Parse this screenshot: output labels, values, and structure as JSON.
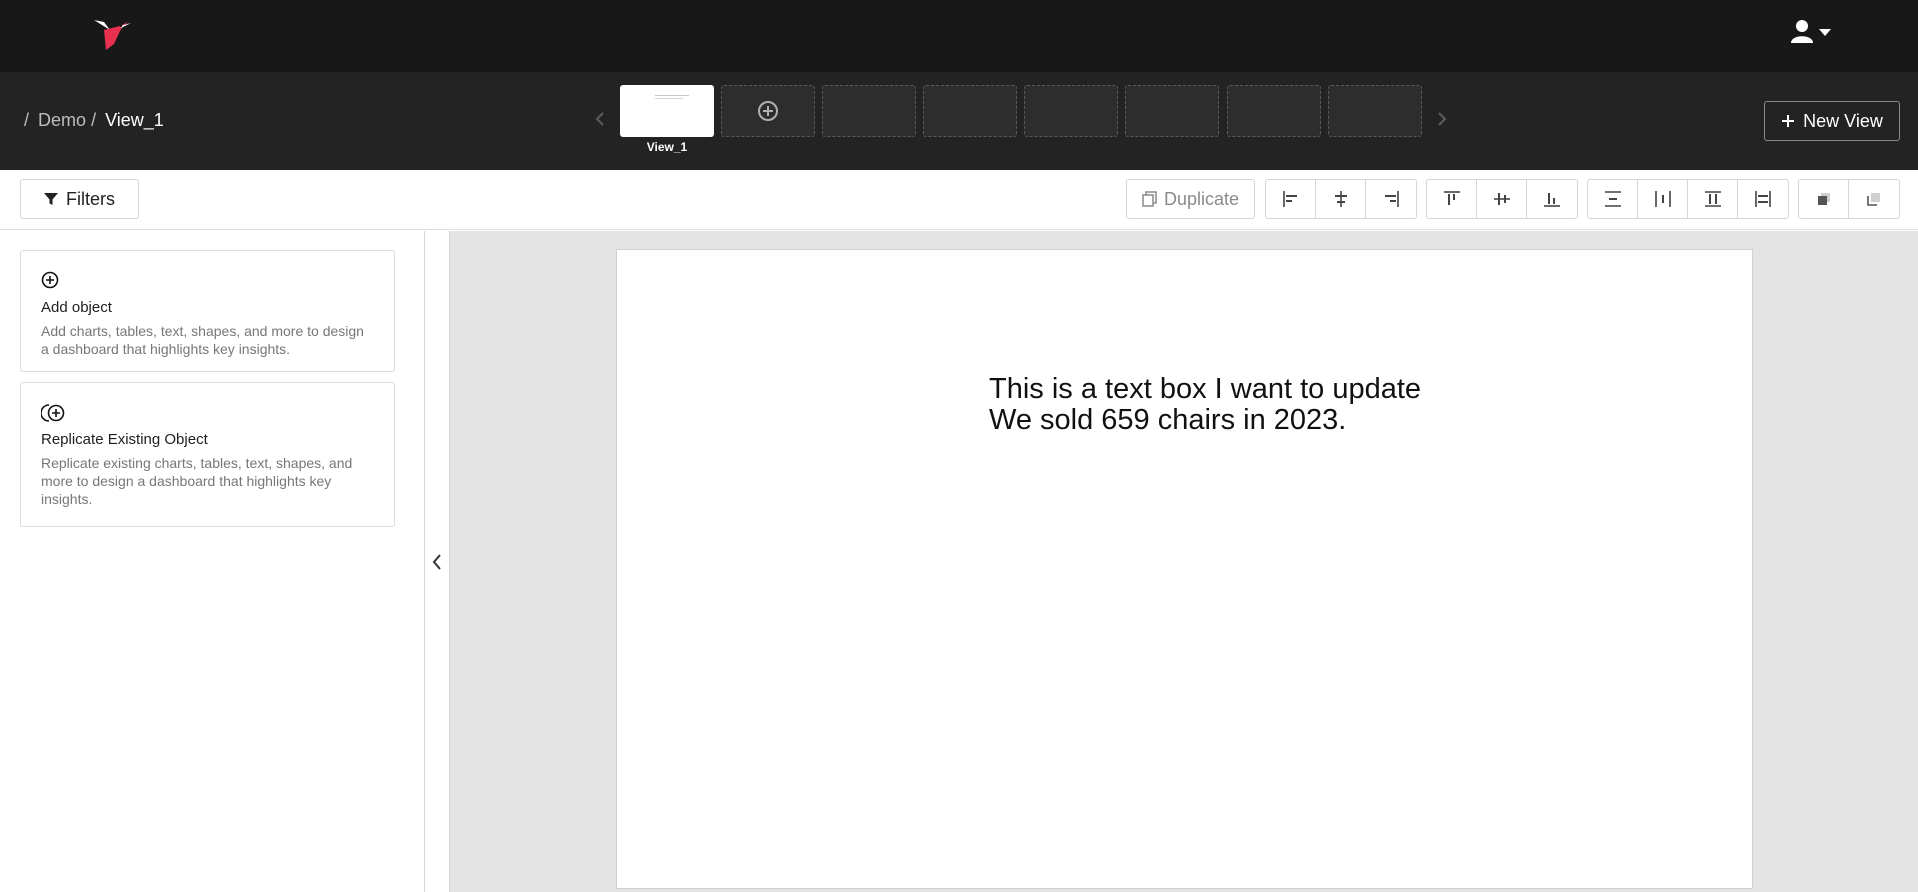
{
  "topbar": {
    "logo_icon": "hummingbird-logo-icon",
    "user_icon": "user-icon",
    "user_caret_icon": "caret-down-icon"
  },
  "breadcrumb": {
    "sep1": "/",
    "project": "Demo",
    "sep2": "/",
    "view": "View_1"
  },
  "views": {
    "prev_icon": "chevron-left-icon",
    "next_icon": "chevron-right-icon",
    "active_label": "View_1",
    "add_icon": "plus-circle-icon",
    "empty_slots": 6
  },
  "new_view": {
    "icon": "plus-icon",
    "label": "New View"
  },
  "toolbar": {
    "filters_label": "Filters",
    "filters_icon": "filter-icon",
    "duplicate_label": "Duplicate",
    "duplicate_icon": "copy-icon",
    "align_horizontal": [
      "align-left-icon",
      "align-center-horizontal-icon",
      "align-right-icon"
    ],
    "align_vertical": [
      "align-top-icon",
      "align-middle-vertical-icon",
      "align-bottom-icon"
    ],
    "distribute": [
      "distribute-vertical-icon",
      "distribute-horizontal-icon",
      "distribute-top-icon",
      "distribute-left-icon"
    ],
    "layering": [
      "bring-forward-icon",
      "send-backward-icon"
    ]
  },
  "left_panel": {
    "add_object": {
      "icon": "plus-circle-icon",
      "title": "Add object",
      "description": "Add charts, tables, text, shapes, and more to design a dashboard that highlights key insights."
    },
    "replicate_object": {
      "icon": "replicate-icon",
      "title": "Replicate Existing Object",
      "description": "Replicate existing charts, tables, text, shapes, and more to design a dashboard that highlights key insights."
    },
    "collapse_icon": "chevron-left-icon"
  },
  "canvas": {
    "text_line1": "This is a text box I want to update",
    "text_line2": "We sold 659 chairs in 2023."
  },
  "colors": {
    "topbar_bg": "#181818",
    "viewbar_bg": "#232323",
    "brand": "#e8314f",
    "canvas_bg": "#e4e4e4"
  }
}
